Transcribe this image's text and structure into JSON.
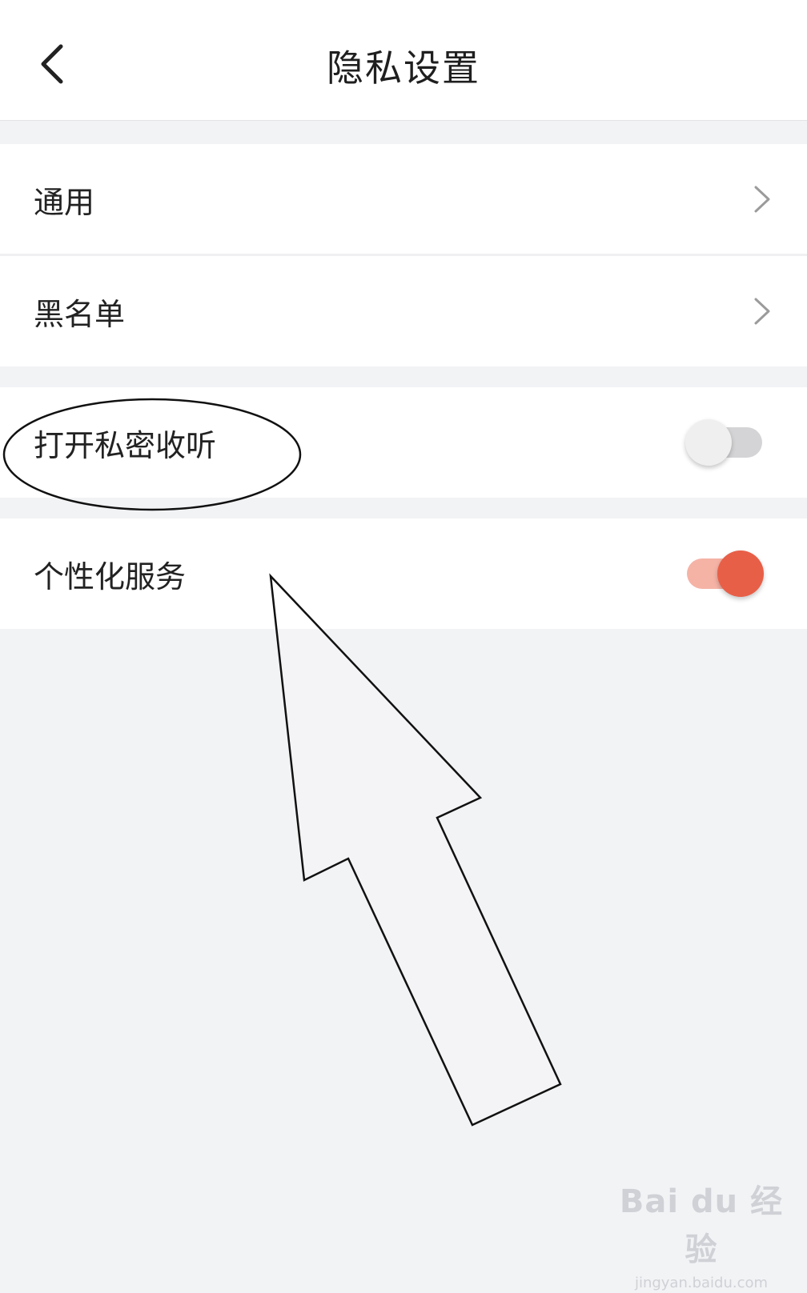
{
  "header": {
    "title": "隐私设置",
    "back_icon": "chevron-left-icon"
  },
  "settings": {
    "general": {
      "label": "通用",
      "icon": "chevron-right-icon"
    },
    "blacklist": {
      "label": "黑名单",
      "icon": "chevron-right-icon"
    },
    "private_listening": {
      "label": "打开私密收听",
      "enabled": false
    },
    "personalized_service": {
      "label": "个性化服务",
      "enabled": true
    }
  },
  "colors": {
    "accent": "#e85f48",
    "accent_track": "#f5b3a6",
    "page_background": "#f2f3f5"
  },
  "watermark": {
    "brand": "Bai du 经验",
    "url": "jingyan.baidu.com"
  }
}
